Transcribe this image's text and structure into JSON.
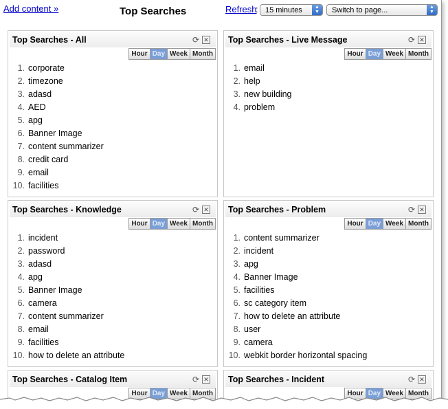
{
  "header": {
    "add_content": "Add content »",
    "title": "Top Searches",
    "refresh": "Refresh",
    "refresh_interval": "15 minutes",
    "switch_page": "Switch to page..."
  },
  "tab_labels": [
    "Hour",
    "Day",
    "Week",
    "Month"
  ],
  "active_tab": "Day",
  "panels": [
    {
      "title": "Top Searches - All",
      "items": [
        "corporate",
        "timezone",
        "adasd",
        "AED",
        "apg",
        "Banner Image",
        "content summarizer",
        "credit card",
        "email",
        "facilities"
      ]
    },
    {
      "title": "Top Searches - Live Message",
      "items": [
        "email",
        "help",
        "new building",
        "problem"
      ]
    },
    {
      "title": "Top Searches - Knowledge",
      "items": [
        "incident",
        "password",
        "adasd",
        "apg",
        "Banner Image",
        "camera",
        "content summarizer",
        "email",
        "facilities",
        "how to delete an attribute"
      ]
    },
    {
      "title": "Top Searches - Problem",
      "items": [
        "content summarizer",
        "incident",
        "apg",
        "Banner Image",
        "facilities",
        "sc category item",
        "how to delete an attribute",
        "user",
        "camera",
        "webkit border horizontal spacing"
      ]
    },
    {
      "title": "Top Searches - Catalog Item",
      "items": []
    },
    {
      "title": "Top Searches - Incident",
      "items": []
    }
  ]
}
